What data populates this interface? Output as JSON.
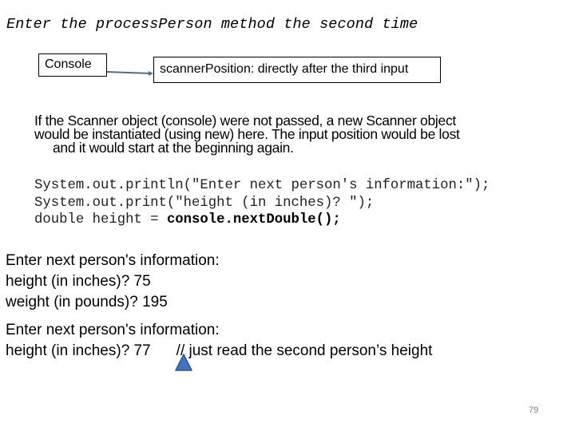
{
  "slide": {
    "heading": "Enter the processPerson method the second time",
    "console_box_label": "Console",
    "scanner_box_label": "scannerPosition:  directly after the third input",
    "explanation": {
      "lines": [
        "If the Scanner object (console) were not passed, a new Scanner object",
        "would be instantiated (using new) here.  The input position would be lost",
        "and it would start at the beginning again."
      ]
    },
    "code": {
      "line1": "System.out.println(\"Enter next person's information:\");",
      "line2": "System.out.print(\"height (in inches)? \");",
      "line3_prefix": "double height = ",
      "line3_bold": "console.nextDouble();"
    },
    "output_block_1": {
      "lines": [
        "Enter next person's information:",
        "height (in inches)?  75",
        "weight (in pounds)?  195"
      ]
    },
    "output_block_2": {
      "line1": "Enter next person's information:",
      "line2_prefix": "height (in inches)?  77",
      "line2_comment": "// just read the second person’s height"
    },
    "page_number": "79",
    "colors": {
      "connector": "#4a6f96",
      "triangle_fill": "#4472c4",
      "triangle_stroke": "#2f5597",
      "page_number": "#7f7f7f"
    }
  }
}
